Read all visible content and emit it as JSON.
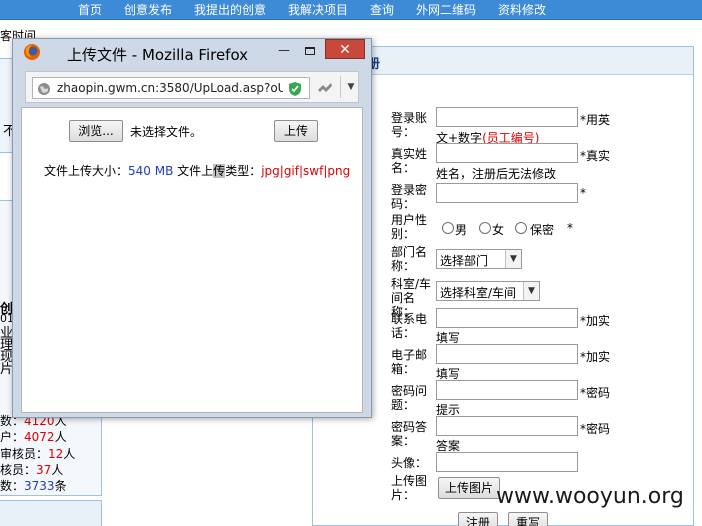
{
  "nav": {
    "items": [
      "首页",
      "创意发布",
      "我提出的创意",
      "我解决项目",
      "查询",
      "外网二维码",
      "资料修改"
    ]
  },
  "background": {
    "fragment_top": "客时间",
    "fragment_reg": "册",
    "left_fragments": [
      "不",
      "创",
      "01",
      "业",
      "理",
      "现",
      "片"
    ],
    "stats": [
      {
        "label": "数：",
        "value": "4120",
        "unit": "人"
      },
      {
        "label": "户：",
        "value": "4072",
        "unit": "人"
      },
      {
        "label": "审核员：",
        "value": "12",
        "unit": "人"
      },
      {
        "label": "核员：",
        "value": "37",
        "unit": "人"
      },
      {
        "label": "数：",
        "value": "3733",
        "unit": "条"
      }
    ]
  },
  "form": {
    "fields": [
      {
        "label": "登录账号：",
        "hint_prefix": "文+数字",
        "hint_red": "(员工编号)",
        "req": "*用英"
      },
      {
        "label": "真实姓名：",
        "hint": "姓名，注册后无法修改",
        "req": "*真实"
      },
      {
        "label": "登录密码：",
        "req": "*"
      },
      {
        "label": "用户性别：",
        "req": "*"
      },
      {
        "label": "部门名称："
      },
      {
        "label": "科室/车间名称："
      },
      {
        "label": "联系电话：",
        "hint": "填写",
        "req": "*加实"
      },
      {
        "label": "电子邮箱：",
        "hint": "填写",
        "req": "*加实"
      },
      {
        "label": "密码问题：",
        "hint": "提示",
        "req": "*密码"
      },
      {
        "label": "密码答案：",
        "hint": "答案",
        "req": "*密码"
      },
      {
        "label": "头像："
      },
      {
        "label": "上传图片："
      }
    ],
    "gender_options": [
      "男",
      "女",
      "保密"
    ],
    "dept_select": "选择部门",
    "office_select": "选择科室/车间",
    "upload_button": "上传图片",
    "register_button": "注册",
    "reset_button": "重写"
  },
  "popup": {
    "title": "上传文件 - Mozilla Firefox",
    "url": "zhaopin.gwm.cn:3580/UpLoad.asp?oUp",
    "browse_button": "浏览...",
    "no_file": "未选择文件。",
    "upload_button": "上传",
    "size_label": "文件上传大小：",
    "size_value": "540 MB",
    "type_label_a": "文件上",
    "type_label_b": "传",
    "type_label_c": "类型：",
    "types": "jpg|gif|swf|png"
  },
  "watermark": "www.wooyun.org",
  "colors": {
    "nav_bg": "#3d8ad6",
    "accent_red": "#e00000",
    "accent_blue": "#1e3cc8",
    "close_red": "#c7493b"
  }
}
